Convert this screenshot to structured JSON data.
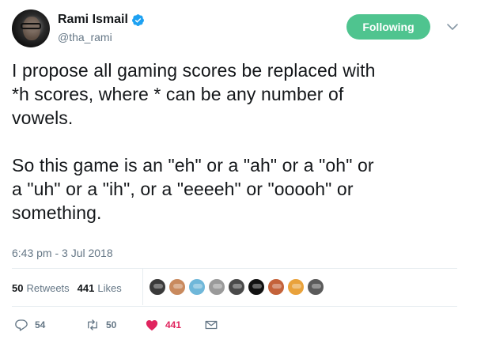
{
  "author": {
    "name": "Rami Ismail",
    "handle": "@tha_rami",
    "verified": true
  },
  "follow_button": {
    "label": "Following",
    "color": "#4fc48f"
  },
  "tweet": {
    "text": "I propose all gaming scores be replaced with\n*h scores, where * can be any number of\nvowels.\n\nSo this game is an \"eh\" or a \"ah\" or a \"oh\" or\na \"uh\" or a \"ih\", or a \"eeeeh\" or \"ooooh\" or\nsomething.",
    "timestamp": "6:43 pm - 3 Jul 2018"
  },
  "stats": {
    "retweets_count": "50",
    "retweets_label": "Retweets",
    "likes_count": "441",
    "likes_label": "Likes"
  },
  "likers": [
    {
      "icon": "liker-avatar",
      "color": "#3a3a3a"
    },
    {
      "icon": "liker-avatar",
      "color": "#c98a5e"
    },
    {
      "icon": "liker-avatar",
      "color": "#6fb7d9"
    },
    {
      "icon": "liker-avatar",
      "color": "#9a9a9a"
    },
    {
      "icon": "liker-avatar",
      "color": "#4a4a4a"
    },
    {
      "icon": "liker-avatar",
      "color": "#111111"
    },
    {
      "icon": "liker-avatar",
      "color": "#c4623a"
    },
    {
      "icon": "liker-avatar",
      "color": "#e9a23b"
    },
    {
      "icon": "liker-avatar",
      "color": "#5b5b5b"
    }
  ],
  "actions": {
    "reply_count": "54",
    "retweet_count": "50",
    "like_count": "441",
    "like_color": "#e0245e"
  },
  "colors": {
    "secondary_text": "#657786",
    "verified_badge": "#1da1f2"
  }
}
